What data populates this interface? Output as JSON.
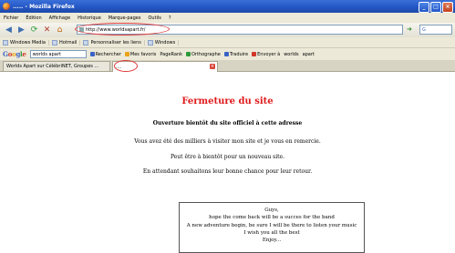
{
  "window": {
    "title": "..... - Mozilla Firefox",
    "buttons": [
      "_",
      "□",
      "×"
    ]
  },
  "menu": {
    "items": [
      "Fichier",
      "Édition",
      "Affichage",
      "Historique",
      "Marque-pages",
      "Outils",
      "?"
    ]
  },
  "nav": {
    "icons": [
      "back-arrow-icon",
      "forward-arrow-icon",
      "reload-icon",
      "stop-icon",
      "home-icon"
    ],
    "url": "http://www.worldsapart.fr/",
    "search_prefix": "G"
  },
  "bookmarks": {
    "items": [
      "Windows Media",
      "Hotmail",
      "Personnaliser les liens",
      "Windows"
    ]
  },
  "googlebar": {
    "logo": "Google",
    "query": "worlds apart",
    "items": [
      "Rechercher",
      "Mes favoris",
      "PageRank",
      "Orthographe",
      "Traduire",
      "Envoyer à",
      "worlds",
      "apart"
    ]
  },
  "tabs": [
    {
      "label": "Worlds Apart sur CélébriNET, Groupes ..."
    },
    {
      "label": "...."
    }
  ],
  "page": {
    "title": "Fermeture du site",
    "subtitle": "Ouverture bientôt du site officiel à cette adresse",
    "lines": [
      "Vous avez été des milliers à visiter mon site et je vous en remercie.",
      "Peut être à bientôt pour un nouveau site.",
      "En attendant souhaitons leur bonne chance pour leur retour."
    ],
    "message": [
      "Guys,",
      "hope the come back will be a succes for the band",
      "A new adventure begin, be sure I will be there to listen your music",
      "I wish you all the best",
      "Enjoy..."
    ]
  },
  "colors": {
    "title_red": "#e0191b",
    "annotation_red": "#e03a3a",
    "titlebar_blue": "#2457c5"
  }
}
